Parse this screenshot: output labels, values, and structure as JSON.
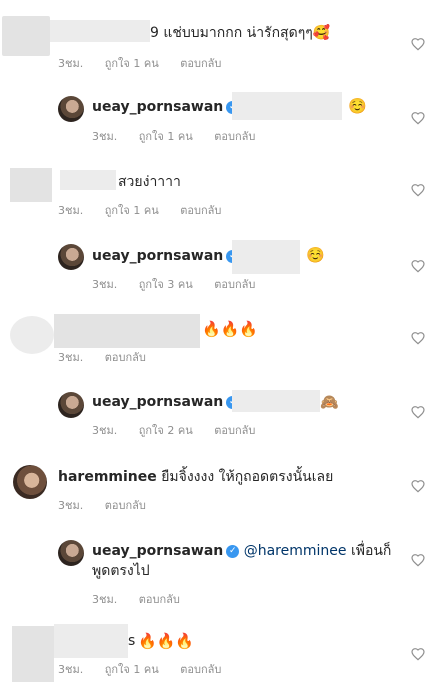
{
  "comments": [
    {
      "id": "c1",
      "text_suffix": "9 แช่บบมากกก น่ารักสุดๆๆ🥰",
      "likes": "ถูกใจ 1 คน",
      "time": "3ชม.",
      "reply": "ตอบกลับ"
    },
    {
      "id": "r1",
      "username": "ueay_pornsawan",
      "emoji": "☺️",
      "time": "3ชม.",
      "likes": "ถูกใจ 1 คน",
      "reply": "ตอบกลับ"
    },
    {
      "id": "c2",
      "text_suffix": "สวยง่าาาา",
      "time": "3ชม.",
      "likes": "ถูกใจ 1 คน",
      "reply": "ตอบกลับ"
    },
    {
      "id": "r2",
      "username": "ueay_pornsawan",
      "emoji": "☺️",
      "time": "3ชม.",
      "likes": "ถูกใจ 3 คน",
      "reply": "ตอบกลับ"
    },
    {
      "id": "c3",
      "emoji": "🔥🔥🔥",
      "time": "3ชม.",
      "reply": "ตอบกลับ"
    },
    {
      "id": "r3",
      "username": "ueay_pornsawan",
      "emoji": "🙈",
      "time": "3ชม.",
      "likes": "ถูกใจ 2 คน",
      "reply": "ตอบกลับ"
    },
    {
      "id": "c4",
      "username": "haremminee",
      "text": "ยืมจิ้งงงง ให้กูถอดตรงนั้นเลย",
      "time": "3ชม.",
      "reply": "ตอบกลับ"
    },
    {
      "id": "r4",
      "username": "ueay_pornsawan",
      "mention": "@haremminee",
      "text_line1": "เพื่อนก็",
      "text_line2": "พูดตรงไป",
      "time": "3ชม.",
      "reply": "ตอบกลับ"
    },
    {
      "id": "c5",
      "text_suffix": "s",
      "emoji": "🔥🔥🔥",
      "time": "3ชม.",
      "likes": "ถูกใจ 1 คน",
      "reply": "ตอบกลับ"
    }
  ],
  "icons": {
    "verified": "verified-badge-icon",
    "like": "heart-outline-icon"
  },
  "colors": {
    "verified": "#3897f0",
    "meta": "#8e8e8e",
    "mention": "#003569"
  }
}
